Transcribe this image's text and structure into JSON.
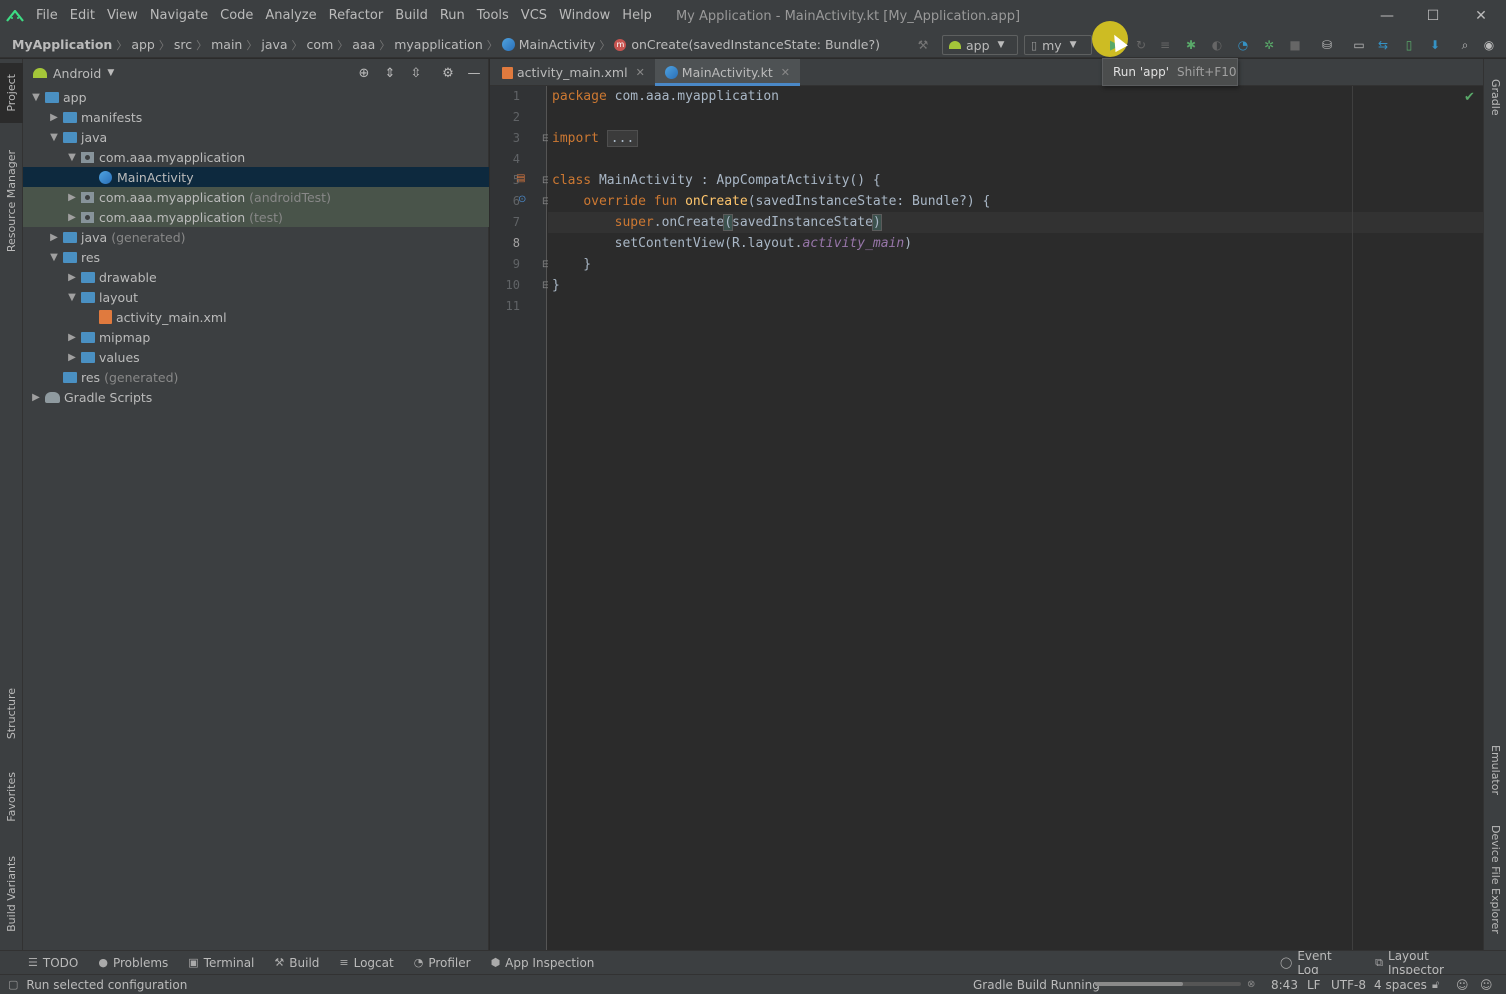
{
  "titlebar": {
    "menu": [
      {
        "label": "File",
        "name": "menu-file"
      },
      {
        "label": "Edit",
        "name": "menu-edit"
      },
      {
        "label": "View",
        "name": "menu-view"
      },
      {
        "label": "Navigate",
        "name": "menu-navigate"
      },
      {
        "label": "Code",
        "name": "menu-code"
      },
      {
        "label": "Analyze",
        "name": "menu-analyze"
      },
      {
        "label": "Refactor",
        "name": "menu-refactor"
      },
      {
        "label": "Build",
        "name": "menu-build"
      },
      {
        "label": "Run",
        "name": "menu-run"
      },
      {
        "label": "Tools",
        "name": "menu-tools"
      },
      {
        "label": "VCS",
        "name": "menu-vcs"
      },
      {
        "label": "Window",
        "name": "menu-window"
      },
      {
        "label": "Help",
        "name": "menu-help"
      }
    ],
    "window_title": "My Application - MainActivity.kt [My_Application.app]"
  },
  "navbar": {
    "crumbs": [
      "MyApplication",
      "app",
      "src",
      "main",
      "java",
      "com",
      "aaa",
      "myapplication"
    ],
    "class_crumb": "MainActivity",
    "method_crumb": "onCreate(savedInstanceState: Bundle?)",
    "run_config": "app",
    "device": "my"
  },
  "tooltip": {
    "label": "Run 'app'",
    "shortcut": "Shift+F10"
  },
  "left_strip": {
    "project": "Project",
    "resource_manager": "Resource Manager",
    "structure": "Structure",
    "favorites": "Favorites",
    "build_variants": "Build Variants"
  },
  "right_strip": {
    "gradle": "Gradle",
    "emulator": "Emulator",
    "device_file_explorer": "Device File Explorer"
  },
  "project": {
    "view_mode": "Android",
    "tree": [
      {
        "label": "app",
        "suffix": "",
        "level": 0,
        "arrow": "▼",
        "icon": "module-folder"
      },
      {
        "label": "manifests",
        "suffix": "",
        "level": 1,
        "arrow": "▶",
        "icon": "folder"
      },
      {
        "label": "java",
        "suffix": "",
        "level": 1,
        "arrow": "▼",
        "icon": "folder"
      },
      {
        "label": "com.aaa.myapplication",
        "suffix": "",
        "level": 2,
        "arrow": "▼",
        "icon": "package"
      },
      {
        "label": "MainActivity",
        "suffix": "",
        "level": 3,
        "arrow": "",
        "icon": "kotlin-class",
        "selected": true
      },
      {
        "label": "com.aaa.myapplication",
        "suffix": "(androidTest)",
        "level": 2,
        "arrow": "▶",
        "icon": "package",
        "test": true
      },
      {
        "label": "com.aaa.myapplication",
        "suffix": "(test)",
        "level": 2,
        "arrow": "▶",
        "icon": "package",
        "test": true
      },
      {
        "label": "java",
        "suffix": "(generated)",
        "level": 1,
        "arrow": "▶",
        "icon": "folder"
      },
      {
        "label": "res",
        "suffix": "",
        "level": 1,
        "arrow": "▼",
        "icon": "folder"
      },
      {
        "label": "drawable",
        "suffix": "",
        "level": 2,
        "arrow": "▶",
        "icon": "folder"
      },
      {
        "label": "layout",
        "suffix": "",
        "level": 2,
        "arrow": "▼",
        "icon": "folder"
      },
      {
        "label": "activity_main.xml",
        "suffix": "",
        "level": 3,
        "arrow": "",
        "icon": "xml-file"
      },
      {
        "label": "mipmap",
        "suffix": "",
        "level": 2,
        "arrow": "▶",
        "icon": "folder"
      },
      {
        "label": "values",
        "suffix": "",
        "level": 2,
        "arrow": "▶",
        "icon": "folder"
      },
      {
        "label": "res",
        "suffix": "(generated)",
        "level": 1,
        "arrow": "",
        "icon": "folder"
      },
      {
        "label": "Gradle Scripts",
        "suffix": "",
        "level": 0,
        "arrow": "▶",
        "icon": "gradle"
      }
    ]
  },
  "editor": {
    "tabs": [
      {
        "label": "activity_main.xml",
        "active": false
      },
      {
        "label": "MainActivity.kt",
        "active": true
      }
    ],
    "current_line": 8,
    "line_numbers": [
      "1",
      "2",
      "3",
      "4",
      "5",
      "6",
      "7",
      "8",
      "9",
      "10",
      "11"
    ]
  },
  "bottom_tools": [
    {
      "label": "TODO",
      "icon": "list-icon"
    },
    {
      "label": "Problems",
      "icon": "problems-icon"
    },
    {
      "label": "Terminal",
      "icon": "terminal-icon"
    },
    {
      "label": "Build",
      "icon": "hammer-icon"
    },
    {
      "label": "Logcat",
      "icon": "logcat-icon"
    },
    {
      "label": "Profiler",
      "icon": "profiler-icon"
    },
    {
      "label": "App Inspection",
      "icon": "inspection-icon"
    }
  ],
  "bottom_right_tools": [
    {
      "label": "Event Log",
      "icon": "event-log-icon"
    },
    {
      "label": "Layout Inspector",
      "icon": "layout-inspector-icon"
    }
  ],
  "statusbar": {
    "message": "Run selected configuration",
    "task": "Gradle Build Running",
    "position": "8:43",
    "line_sep": "LF",
    "encoding": "UTF-8",
    "indent": "4 spaces"
  }
}
